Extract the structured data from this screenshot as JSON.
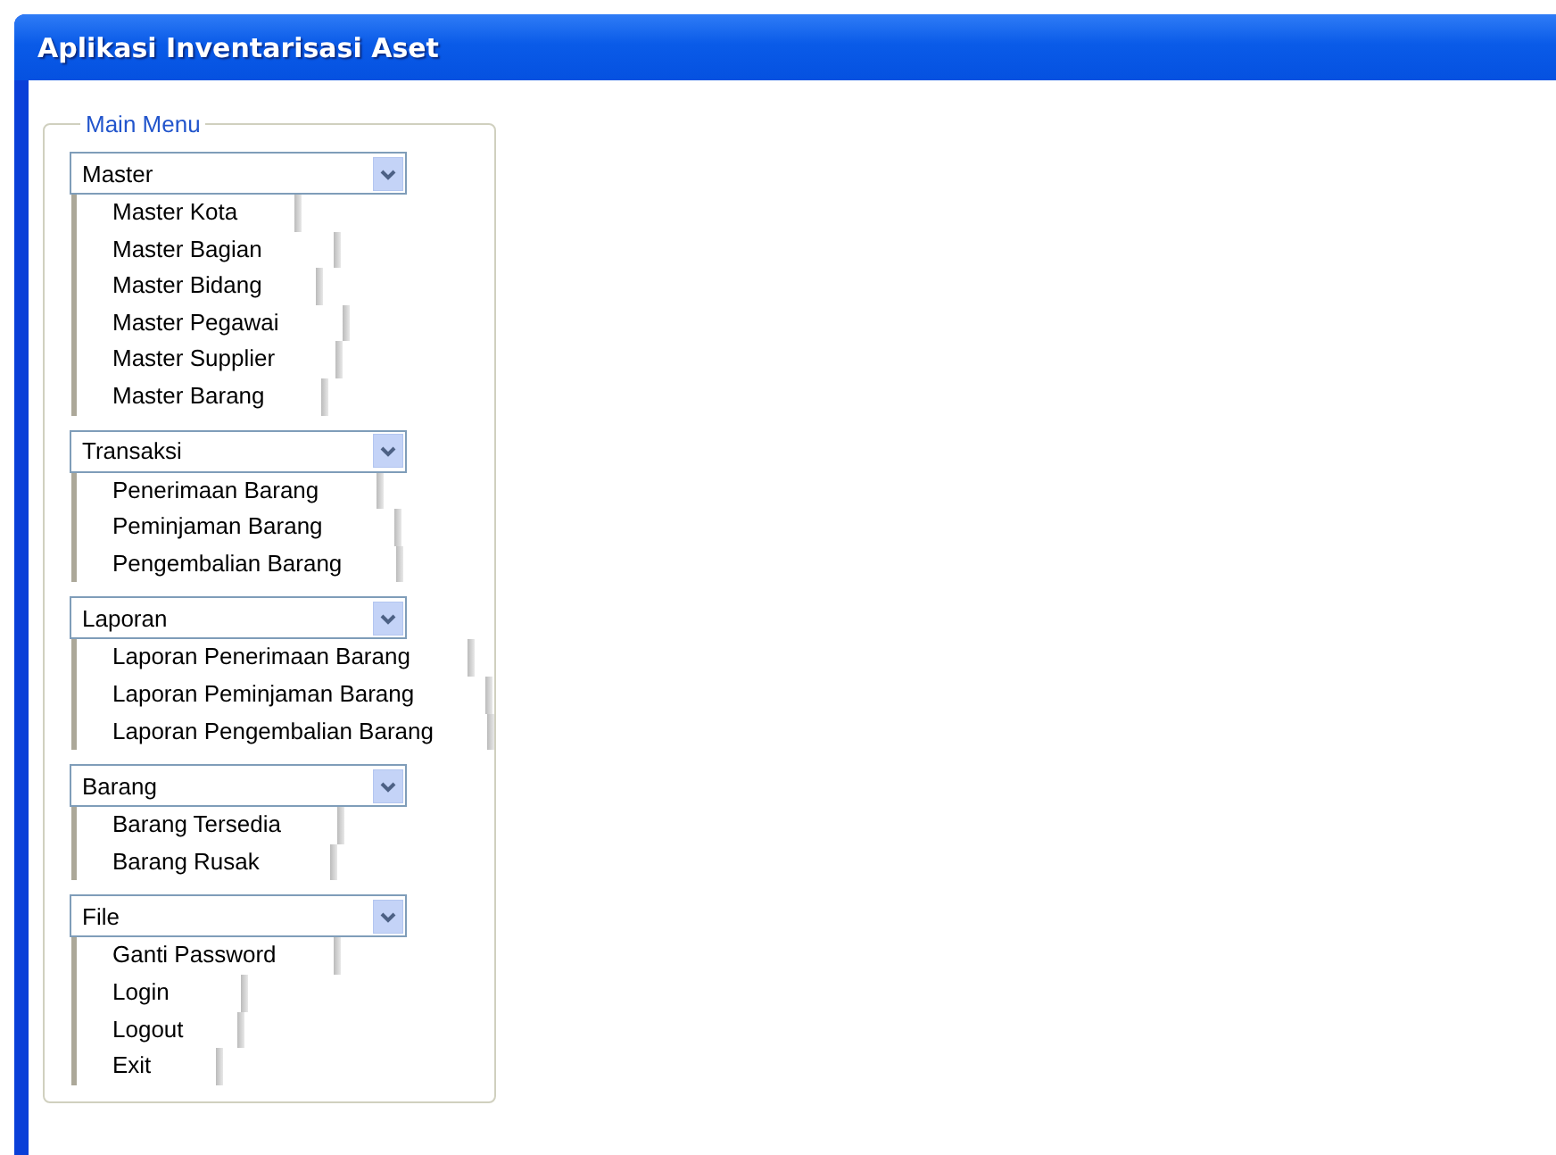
{
  "window": {
    "title": "Aplikasi Inventarisasi Aset"
  },
  "main_menu": {
    "legend": "Main Menu",
    "groups": [
      {
        "label": "Master",
        "items": [
          "Master Kota",
          "Master Bagian",
          "Master Bidang",
          "Master Pegawai",
          "Master Supplier",
          "Master Barang"
        ]
      },
      {
        "label": "Transaksi",
        "items": [
          "Penerimaan Barang",
          "Peminjaman Barang",
          "Pengembalian Barang"
        ]
      },
      {
        "label": "Laporan",
        "items": [
          "Laporan Penerimaan Barang",
          "Laporan Peminjaman Barang",
          "Laporan Pengembalian Barang"
        ]
      },
      {
        "label": "Barang",
        "items": [
          "Barang Tersedia",
          "Barang Rusak"
        ]
      },
      {
        "label": "File",
        "items": [
          "Ganti Password",
          "Login",
          "Logout",
          "Exit"
        ]
      }
    ]
  }
}
